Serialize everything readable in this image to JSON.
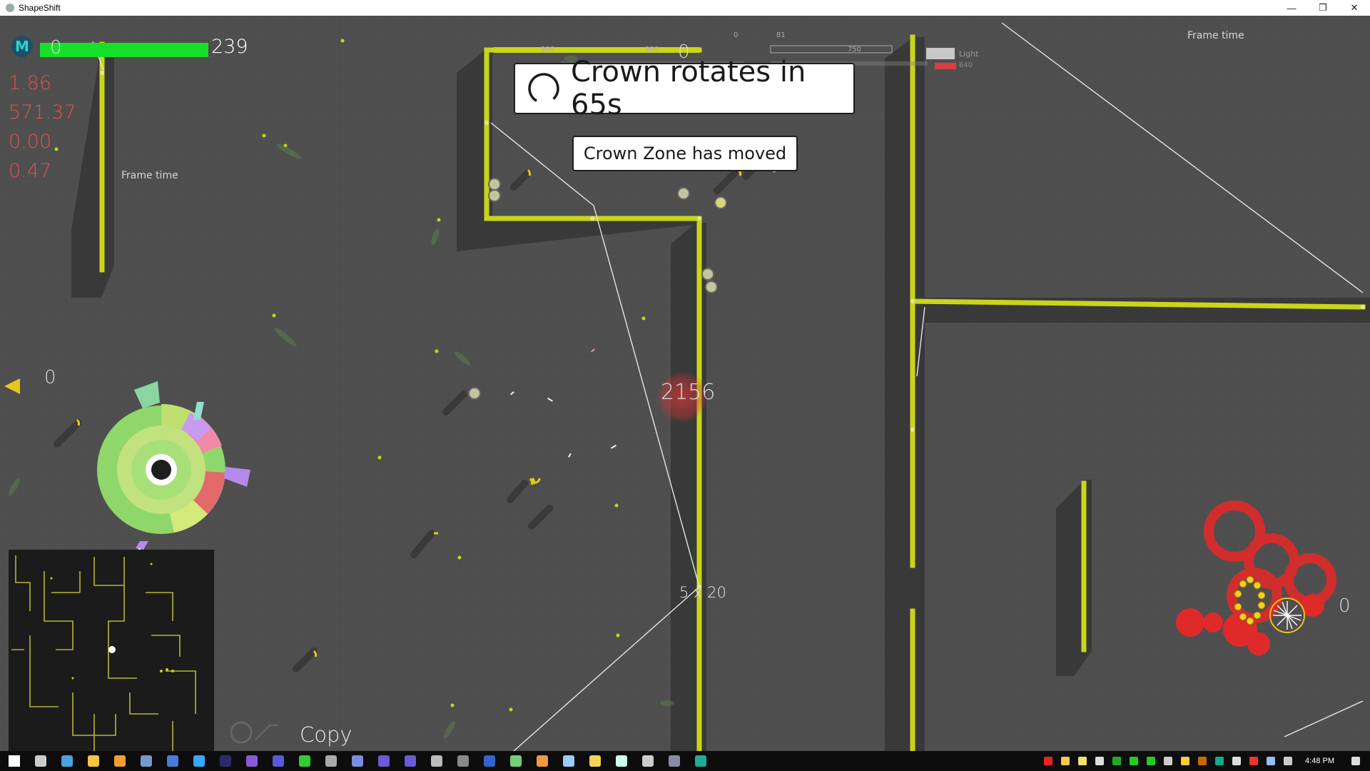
{
  "window": {
    "title": "ShapeShift",
    "controls": {
      "minimize": "—",
      "restore": "❐",
      "close": "✕"
    }
  },
  "hud": {
    "badge": "M",
    "health_value": "239",
    "health_fraction": 1.0,
    "zero_top_left": "0",
    "stats": [
      "1.86",
      "571.37",
      "0.00",
      "0.47"
    ],
    "frame_time_left": "Frame time",
    "frame_time_right": "Frame time",
    "top_counter": "0",
    "tiny_numbers": [
      "900",
      "900",
      "0",
      "81",
      "750"
    ],
    "light_label": "Light",
    "small_value": "640",
    "zero_left": "0",
    "zero_right": "0",
    "center_marker": "2156",
    "size_label": "5 x 20",
    "copy_label": "Copy"
  },
  "banners": {
    "crown": "Crown rotates in 65s",
    "zone": "Crown Zone has moved"
  },
  "colors": {
    "wall": "#c8d61a",
    "floor": "#4e4e4e",
    "health": "#17e02a",
    "stats": "#e34f4f",
    "enemy": "#e02a2a"
  },
  "taskbar": {
    "time": "4:48 PM",
    "icons": [
      "windows-start-icon",
      "task-view-icon",
      "chrome-icon",
      "file-explorer-icon",
      "media-icon",
      "notes-icon",
      "word-icon",
      "browser-icon",
      "steam-icon",
      "visual-studio-icon",
      "vs-code-icon",
      "hammer-icon",
      "terminal-icon",
      "discord-icon",
      "eclipse-icon",
      "eclipse-icon-2",
      "unity-icon",
      "obs-icon",
      "photoshop-icon",
      "vb-icon",
      "git-icon",
      "remote-icon",
      "sticky-notes-icon",
      "calculator-icon",
      "wheel-icon",
      "vs-icon-2",
      "shapeshift-icon"
    ]
  }
}
